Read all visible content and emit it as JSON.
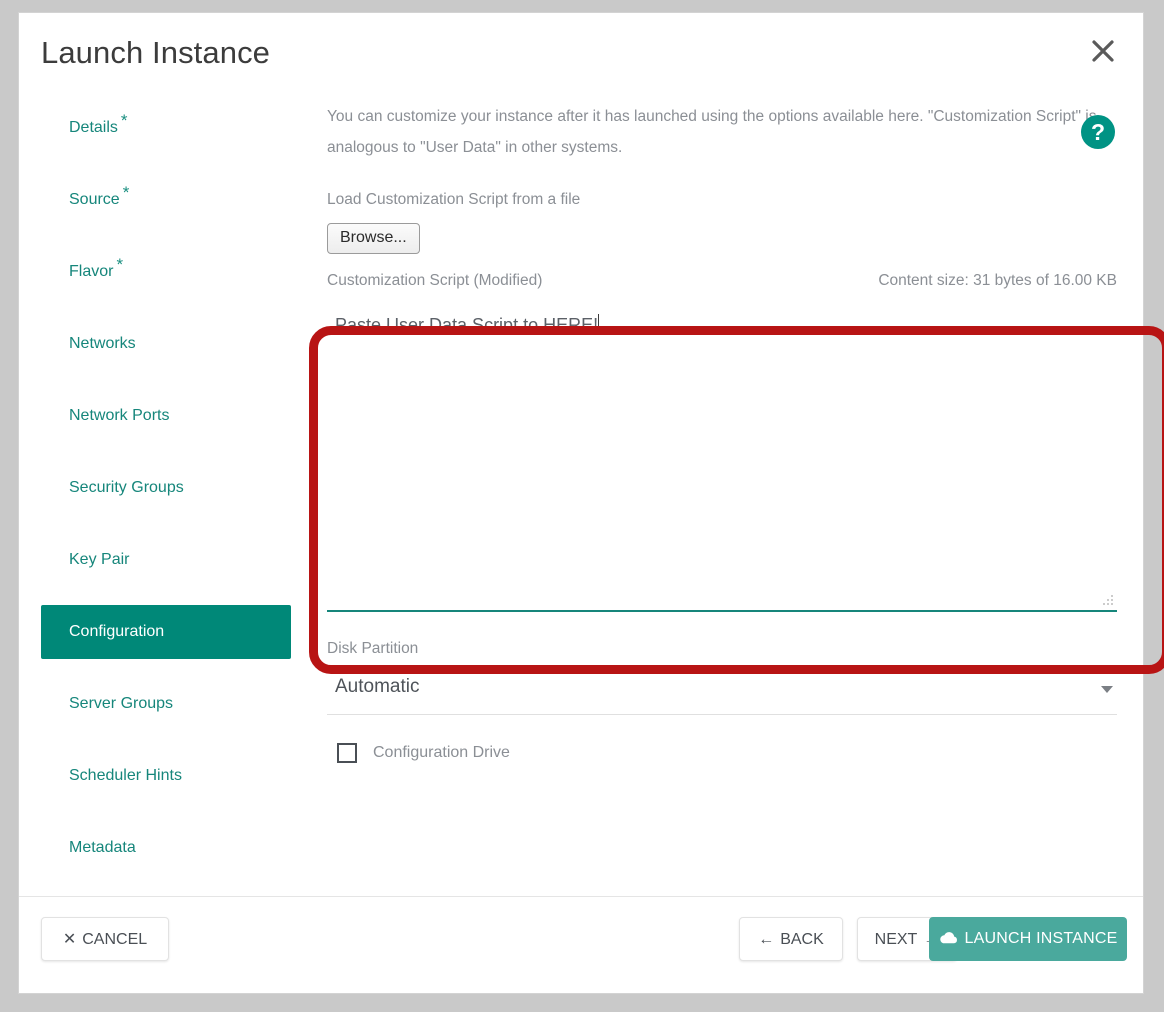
{
  "dialog": {
    "title": "Launch Instance",
    "close_icon": "close-icon"
  },
  "sidebar": {
    "items": [
      {
        "label": "Details",
        "required": "*",
        "active": false
      },
      {
        "label": "Source",
        "required": "*",
        "active": false
      },
      {
        "label": "Flavor",
        "required": "*",
        "active": false
      },
      {
        "label": "Networks",
        "required": "",
        "active": false
      },
      {
        "label": "Network Ports",
        "required": "",
        "active": false
      },
      {
        "label": "Security Groups",
        "required": "",
        "active": false
      },
      {
        "label": "Key Pair",
        "required": "",
        "active": false
      },
      {
        "label": "Configuration",
        "required": "",
        "active": true
      },
      {
        "label": "Server Groups",
        "required": "",
        "active": false
      },
      {
        "label": "Scheduler Hints",
        "required": "",
        "active": false
      },
      {
        "label": "Metadata",
        "required": "",
        "active": false
      }
    ]
  },
  "main": {
    "intro": "You can customize your instance after it has launched using the options available here. \"Customization Script\" is analogous to \"User Data\" in other systems.",
    "help_icon": "help-question-icon",
    "help_glyph": "?",
    "load_label": "Load Customization Script from a file",
    "browse_label": "Browse...",
    "script_label": "Customization Script (Modified)",
    "content_size": "Content size: 31 bytes of 16.00 KB",
    "script_value": "Paste User Data Script to HERE!",
    "disk_partition_label": "Disk Partition",
    "disk_partition_value": "Automatic",
    "config_drive_label": "Configuration Drive",
    "config_drive_checked": false
  },
  "footer": {
    "cancel_label": "CANCEL",
    "cancel_glyph": "✕",
    "back_label": "BACK",
    "back_glyph": "←",
    "next_label": "NEXT",
    "next_glyph": "→",
    "launch_label": "LAUNCH INSTANCE",
    "launch_icon": "cloud-upload-icon"
  },
  "annotation": {
    "shape": "rounded-rectangle-highlight",
    "color": "#b81414"
  },
  "colors": {
    "accent_teal": "#008878",
    "link_teal": "#16867b",
    "launch_teal": "#4aa99d",
    "annotation_red": "#b81414",
    "muted_text": "#8b8f95"
  }
}
